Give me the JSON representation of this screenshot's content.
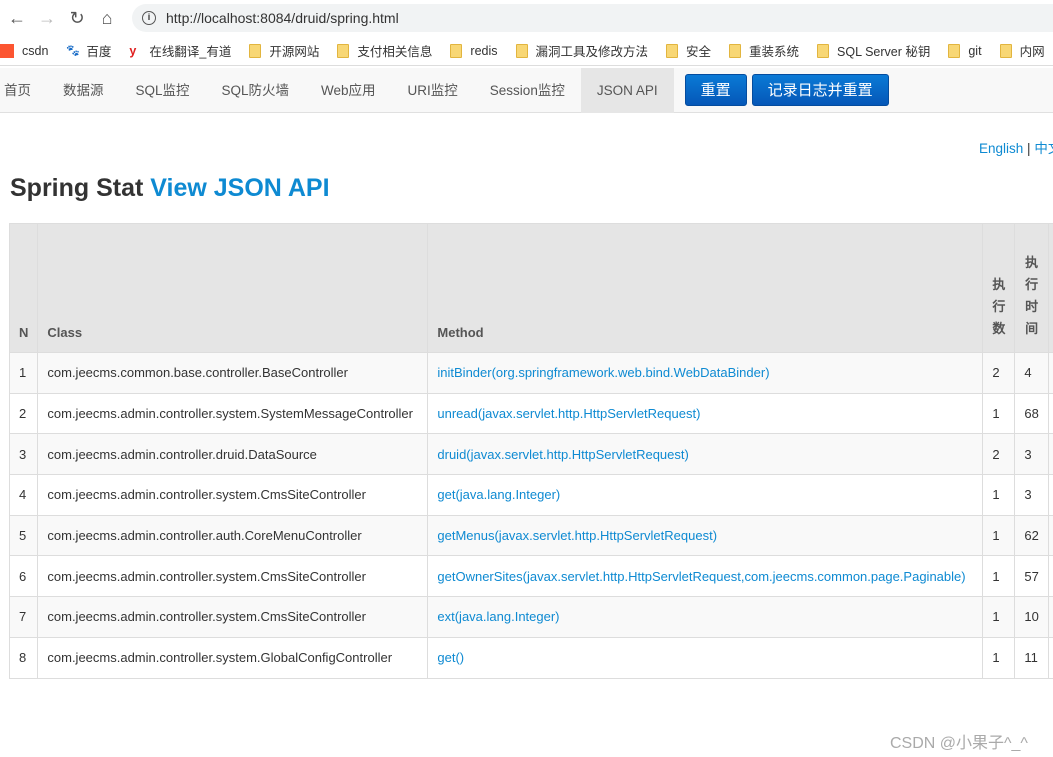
{
  "browser": {
    "url": "http://localhost:8084/druid/spring.html",
    "bookmarks": [
      {
        "label": "csdn",
        "icon": "csdn-logo"
      },
      {
        "label": "百度",
        "icon": "baidu-logo"
      },
      {
        "label": "在线翻译_有道",
        "icon": "youdao-logo"
      },
      {
        "label": "开源网站",
        "icon": "folder"
      },
      {
        "label": "支付相关信息",
        "icon": "folder"
      },
      {
        "label": "redis",
        "icon": "folder"
      },
      {
        "label": "漏洞工具及修改方法",
        "icon": "folder"
      },
      {
        "label": "安全",
        "icon": "folder"
      },
      {
        "label": "重装系统",
        "icon": "folder"
      },
      {
        "label": "SQL Server 秘钥",
        "icon": "folder"
      },
      {
        "label": "git",
        "icon": "folder"
      },
      {
        "label": "内网",
        "icon": "folder"
      }
    ]
  },
  "nav": {
    "items": [
      "首页",
      "数据源",
      "SQL监控",
      "SQL防火墙",
      "Web应用",
      "URI监控",
      "Session监控",
      "JSON API"
    ],
    "active": "JSON API",
    "reset": "重置",
    "log_reset": "记录日志并重置"
  },
  "lang": {
    "english": "English",
    "sep": "|",
    "chinese": "中文"
  },
  "title": {
    "main": "Spring Stat",
    "link": "View JSON API"
  },
  "table": {
    "headers": [
      "N",
      "Class",
      "Method",
      "执行数",
      "执行时间"
    ],
    "rows": [
      [
        "1",
        "com.jeecms.common.base.controller.BaseController",
        "initBinder(org.springframework.web.bind.WebDataBinder)",
        "2",
        "4"
      ],
      [
        "2",
        "com.jeecms.admin.controller.system.SystemMessageController",
        "unread(javax.servlet.http.HttpServletRequest)",
        "1",
        "68"
      ],
      [
        "3",
        "com.jeecms.admin.controller.druid.DataSource",
        "druid(javax.servlet.http.HttpServletRequest)",
        "2",
        "3"
      ],
      [
        "4",
        "com.jeecms.admin.controller.system.CmsSiteController",
        "get(java.lang.Integer)",
        "1",
        "3"
      ],
      [
        "5",
        "com.jeecms.admin.controller.auth.CoreMenuController",
        "getMenus(javax.servlet.http.HttpServletRequest)",
        "1",
        "62"
      ],
      [
        "6",
        "com.jeecms.admin.controller.system.CmsSiteController",
        "getOwnerSites(javax.servlet.http.HttpServletRequest,com.jeecms.common.page.Paginable)",
        "1",
        "57"
      ],
      [
        "7",
        "com.jeecms.admin.controller.system.CmsSiteController",
        "ext(java.lang.Integer)",
        "1",
        "10"
      ],
      [
        "8",
        "com.jeecms.admin.controller.system.GlobalConfigController",
        "get()",
        "1",
        "11"
      ]
    ]
  },
  "watermark": "CSDN @小果子^_^"
}
